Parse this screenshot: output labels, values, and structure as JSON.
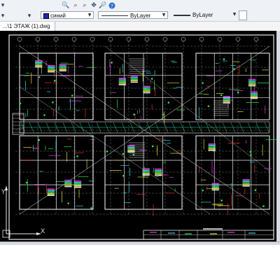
{
  "toolbar": {
    "icons": [
      "zoom-window-icon",
      "zoom-previous-icon",
      "zoom-realtime-icon",
      "pan-icon",
      "zoom-extents-icon",
      "help-icon"
    ]
  },
  "properties": {
    "color": {
      "value": "синий",
      "swatch": "#1f24b8"
    },
    "linetype": {
      "value": "ByLayer"
    },
    "lineweight": {
      "value": "ByLayer"
    }
  },
  "document": {
    "tab_label": "...\\1 ЭТАЖ (1).dwg"
  },
  "ucs": {
    "x_label": "X",
    "y_label": "Y"
  },
  "colors": {
    "background": "#000000",
    "cyan": "#33d6e0",
    "magenta": "#e23ee6",
    "green": "#2ee24a",
    "yellow": "#e6e13b",
    "red": "#e23131",
    "white": "#e8e8e8",
    "grey": "#8b8b8b"
  }
}
